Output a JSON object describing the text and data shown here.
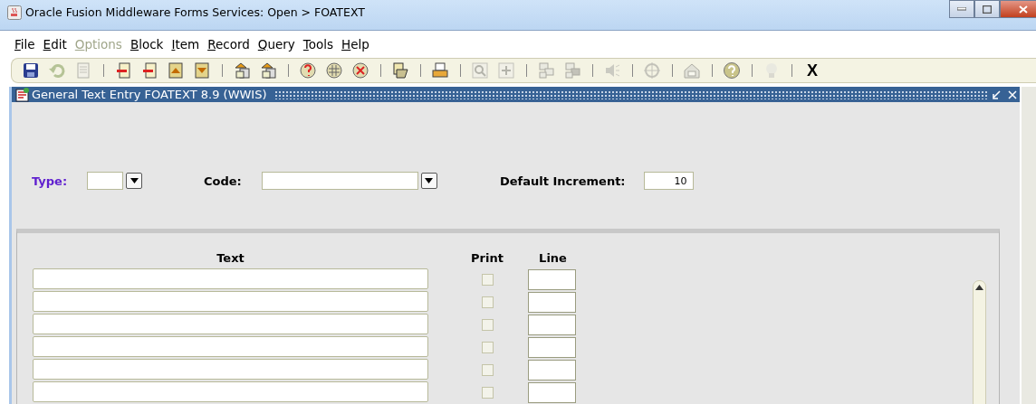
{
  "window": {
    "title": "Oracle Fusion Middleware Forms Services:  Open > FOATEXT"
  },
  "menu": [
    {
      "label": "File",
      "disabled": false
    },
    {
      "label": "Edit",
      "disabled": false
    },
    {
      "label": "Options",
      "disabled": true
    },
    {
      "label": "Block",
      "disabled": false
    },
    {
      "label": "Item",
      "disabled": false
    },
    {
      "label": "Record",
      "disabled": false
    },
    {
      "label": "Query",
      "disabled": false
    },
    {
      "label": "Tools",
      "disabled": false
    },
    {
      "label": "Help",
      "disabled": false
    }
  ],
  "toolbar": {
    "exit_label": "X"
  },
  "form": {
    "title": "General Text Entry  FOATEXT  8.9  (WWIS)",
    "key_fields": [
      {
        "label": "Type:",
        "kind": "dropdown",
        "highlight": true
      },
      {
        "label": "Code:",
        "kind": "dropdown",
        "highlight": false
      },
      {
        "label": "Default Increment:",
        "value": "10",
        "kind": "number",
        "highlight": false
      }
    ],
    "table": {
      "columns": [
        "Text",
        "Print",
        "Line"
      ],
      "rows": [
        {
          "print": false
        },
        {
          "print": false
        },
        {
          "print": false
        },
        {
          "print": false
        },
        {
          "print": false
        },
        {
          "print": false
        }
      ]
    }
  }
}
